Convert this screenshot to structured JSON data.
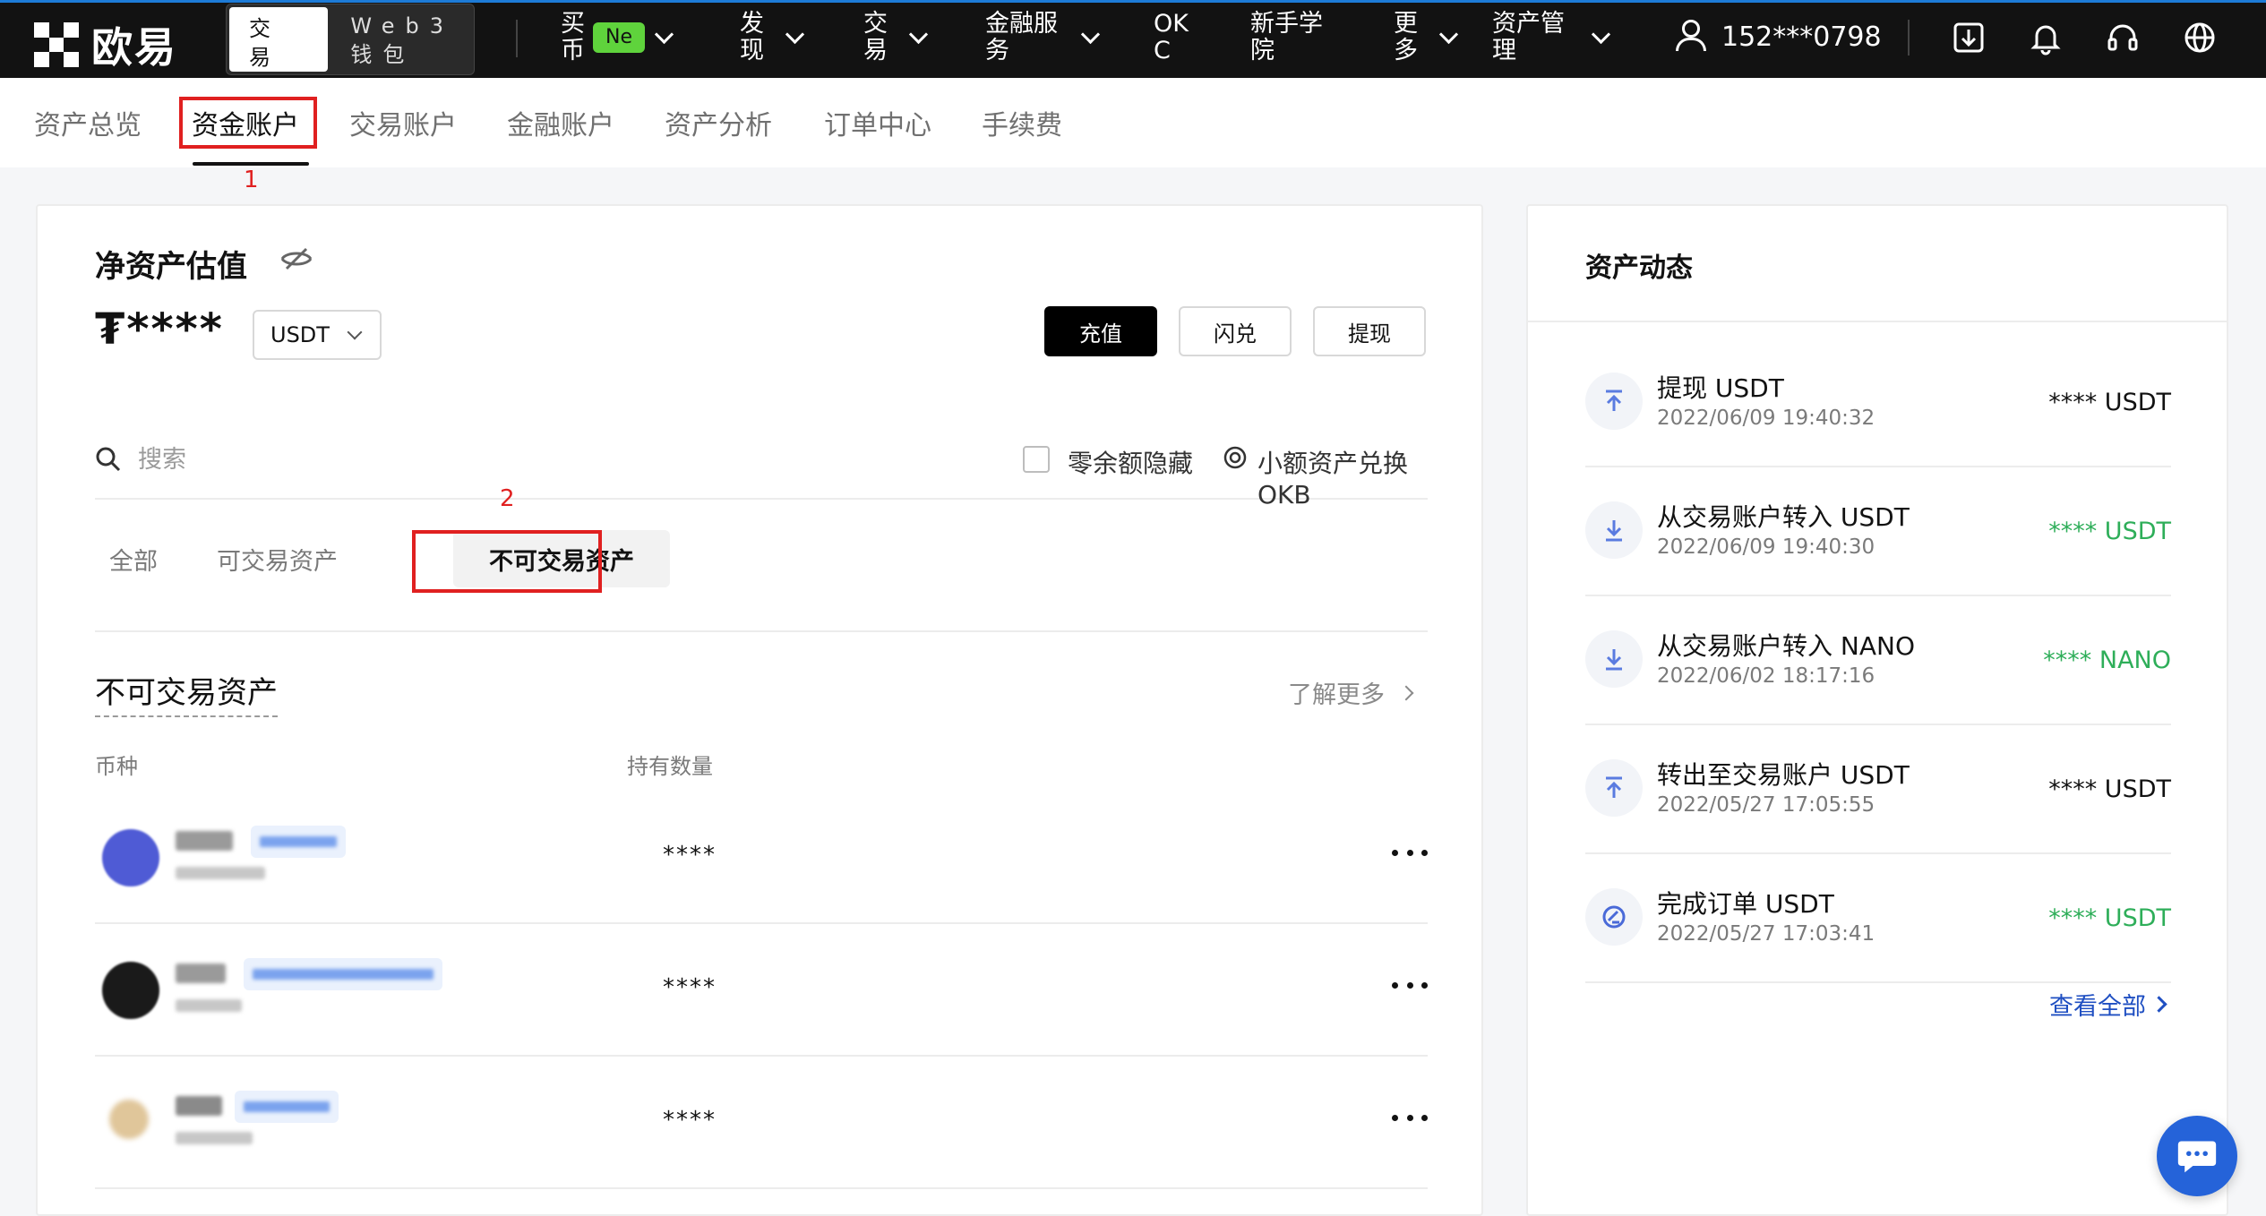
{
  "brand": {
    "name": "欧易"
  },
  "mode_switch": {
    "exchange": "交易所",
    "web3": "Web3 钱包"
  },
  "nav": {
    "buy": "买币",
    "buy_badge": "Ne",
    "discover": "发现",
    "trade": "交易",
    "finance": "金融服务",
    "okc": "OKC",
    "learn": "新手学院",
    "more": "更多",
    "asset_mgmt": "资产管理"
  },
  "user": {
    "phone": "152***0798"
  },
  "subnav": {
    "tabs": [
      {
        "label": "资产总览"
      },
      {
        "label": "资金账户"
      },
      {
        "label": "交易账户"
      },
      {
        "label": "金融账户"
      },
      {
        "label": "资产分析"
      },
      {
        "label": "订单中心"
      },
      {
        "label": "手续费"
      }
    ],
    "active_index": 1
  },
  "annotations": {
    "step1": "1",
    "step2": "2"
  },
  "overview": {
    "title": "净资产估值",
    "value": "₮****",
    "currency": "USDT",
    "deposit": "充值",
    "convert": "闪兑",
    "withdraw": "提现"
  },
  "search": {
    "placeholder": "搜索",
    "hide_zero": "零余额隐藏",
    "small_convert": "小额资产兑换OKB"
  },
  "filters": {
    "all": "全部",
    "tradable": "可交易资产",
    "non_tradable": "不可交易资产"
  },
  "section": {
    "title": "不可交易资产",
    "learn_more": "了解更多",
    "col_coin": "币种",
    "col_qty": "持有数量"
  },
  "assets": [
    {
      "qty": "****"
    },
    {
      "qty": "****"
    },
    {
      "qty": "****"
    }
  ],
  "activity": {
    "title": "资产动态",
    "view_all": "查看全部",
    "items": [
      {
        "title": "提现 USDT",
        "time": "2022/06/09 19:40:32",
        "amount": "**** USDT",
        "color": "#121212",
        "icon": "arrow-up-icon"
      },
      {
        "title": "从交易账户转入 USDT",
        "time": "2022/06/09 19:40:30",
        "amount": "**** USDT",
        "color": "#2eae59",
        "icon": "arrow-down-icon"
      },
      {
        "title": "从交易账户转入 NANO",
        "time": "2022/06/02 18:17:16",
        "amount": "**** NANO",
        "color": "#2eae59",
        "icon": "arrow-down-icon"
      },
      {
        "title": "转出至交易账户 USDT",
        "time": "2022/05/27 17:05:55",
        "amount": "**** USDT",
        "color": "#121212",
        "icon": "arrow-up-icon"
      },
      {
        "title": "完成订单 USDT",
        "time": "2022/05/27 17:03:41",
        "amount": "**** USDT",
        "color": "#2eae59",
        "icon": "order-icon"
      }
    ]
  },
  "colors": {
    "accent_blue": "#2563d9",
    "green": "#2eae59",
    "annotation_red": "#e02020"
  }
}
